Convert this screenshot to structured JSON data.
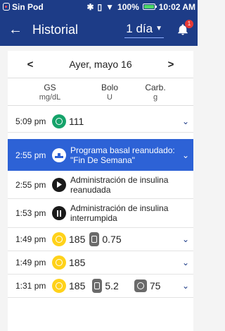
{
  "status": {
    "carrier": "Sin Pod",
    "battery": "100%",
    "time": "10:02 AM"
  },
  "appbar": {
    "title": "Historial",
    "range": "1 día",
    "badge_count": "1"
  },
  "datenav": {
    "prev": "<",
    "date": "Ayer, mayo 16",
    "next": ">"
  },
  "columns": [
    {
      "header": "GS",
      "unit": "mg/dL"
    },
    {
      "header": "Bolo",
      "unit": "U"
    },
    {
      "header": "Carb.",
      "unit": "g"
    }
  ],
  "rows": [
    {
      "time": "5:09 pm",
      "gs": "111"
    },
    {
      "time": "2:55 pm",
      "line1": "Programa basal reanudado:",
      "line2": "\"Fin De Semana\""
    },
    {
      "time": "2:55 pm",
      "line1": "Administración de insulina",
      "line2": "reanudada"
    },
    {
      "time": "1:53 pm",
      "line1": "Administración de insulina",
      "line2": "interrumpida"
    },
    {
      "time": "1:49 pm",
      "gs": "185",
      "bolus": "0.75"
    },
    {
      "time": "1:49 pm",
      "gs": "185"
    },
    {
      "time": "1:31 pm",
      "gs": "185",
      "bolus": "5.2",
      "carbs": "75"
    }
  ],
  "colors": {
    "header": "#1d3c87",
    "selected": "#2d62d6",
    "gs_in_range": "#15a36a",
    "gs_high": "#ffd21a"
  },
  "icons": [
    "back-arrow-icon",
    "bell-icon",
    "glucose-icon",
    "basal-resume-icon",
    "play-icon",
    "pause-icon",
    "insulin-pen-icon",
    "carbs-icon",
    "chevron-down-icon"
  ]
}
